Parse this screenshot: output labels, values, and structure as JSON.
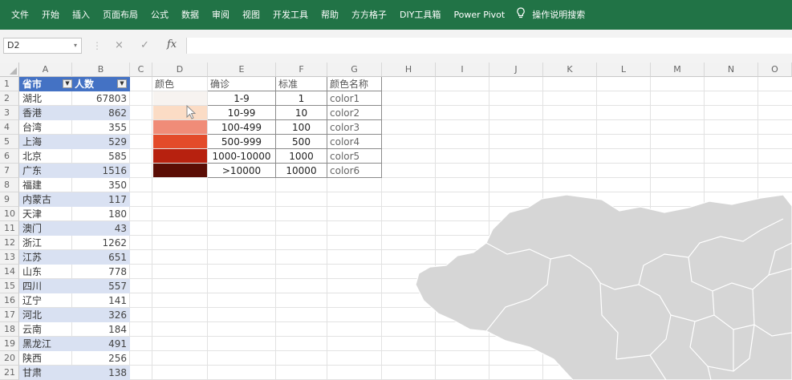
{
  "ribbon": {
    "tabs": [
      "文件",
      "开始",
      "插入",
      "页面布局",
      "公式",
      "数据",
      "审阅",
      "视图",
      "开发工具",
      "帮助",
      "方方格子",
      "DIY工具箱",
      "Power Pivot"
    ],
    "search_label": "操作说明搜索",
    "accent": "#217346"
  },
  "formula_bar": {
    "name_box": "D2",
    "cancel_icon": "×",
    "enter_icon": "✓",
    "fx_icon": "fx",
    "formula": ""
  },
  "columns": [
    "A",
    "B",
    "C",
    "D",
    "E",
    "F",
    "G",
    "H",
    "I",
    "J",
    "K",
    "L",
    "M",
    "N",
    "O"
  ],
  "rows": [
    "1",
    "2",
    "3",
    "4",
    "5",
    "6",
    "7",
    "8",
    "9",
    "10",
    "11",
    "12",
    "13",
    "14",
    "15",
    "16",
    "17",
    "18",
    "19",
    "20",
    "21"
  ],
  "table": {
    "headers": [
      "省市",
      "人数"
    ],
    "rows": [
      [
        "湖北",
        "67803"
      ],
      [
        "香港",
        "862"
      ],
      [
        "台湾",
        "355"
      ],
      [
        "上海",
        "529"
      ],
      [
        "北京",
        "585"
      ],
      [
        "广东",
        "1516"
      ],
      [
        "福建",
        "350"
      ],
      [
        "内蒙古",
        "117"
      ],
      [
        "天津",
        "180"
      ],
      [
        "澳门",
        "43"
      ],
      [
        "浙江",
        "1262"
      ],
      [
        "江苏",
        "651"
      ],
      [
        "山东",
        "778"
      ],
      [
        "四川",
        "557"
      ],
      [
        "辽宁",
        "141"
      ],
      [
        "河北",
        "326"
      ],
      [
        "云南",
        "184"
      ],
      [
        "黑龙江",
        "491"
      ],
      [
        "陕西",
        "256"
      ],
      [
        "甘肃",
        "138"
      ]
    ],
    "header_color": "#4472c4",
    "band_color": "#d9e1f2"
  },
  "legend": {
    "headers": [
      "颜色",
      "确诊",
      "标准",
      "颜色名称"
    ],
    "rows": [
      {
        "range": "1-9",
        "std": "1",
        "name": "color1",
        "color": "#f7f3f0"
      },
      {
        "range": "10-99",
        "std": "10",
        "name": "color2",
        "color": "#fbdcc5"
      },
      {
        "range": "100-499",
        "std": "100",
        "name": "color3",
        "color": "#f08c78"
      },
      {
        "range": "500-999",
        "std": "500",
        "name": "color4",
        "color": "#e34b2a"
      },
      {
        "range": "1000-10000",
        "std": "1000",
        "name": "color5",
        "color": "#b7210f"
      },
      {
        "range": ">10000",
        "std": "10000",
        "name": "color6",
        "color": "#5a0d05"
      }
    ]
  },
  "map": {
    "fill": "#d6d6d6",
    "border": "#ffffff"
  }
}
